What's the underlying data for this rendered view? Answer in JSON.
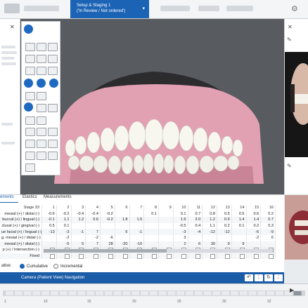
{
  "header": {
    "stage_tab_title": "Setup & Staging 1",
    "stage_tab_status": "('In Review / Not ordered')"
  },
  "table_tabs": [
    "ements",
    "Elastics",
    "Measurements"
  ],
  "table": {
    "header_label": "Stage 33",
    "columns": [
      "1",
      "2",
      "3",
      "4",
      "5",
      "6",
      "7",
      "8",
      "9",
      "10",
      "11",
      "12",
      "13",
      "14",
      "15",
      "16"
    ],
    "rows": [
      {
        "label": "mesial (+) / distal (-)",
        "cells": [
          "-0.6",
          "-0.2",
          "-0.4",
          "-0.4",
          "-0.2",
          "",
          "",
          "0.1",
          "",
          "0.1",
          "0.7",
          "0.8",
          "0.5",
          "0.5",
          "0.6",
          "0.2"
        ]
      },
      {
        "label": "buccal (+) / lingual (-)",
        "cells": [
          "-0.1",
          "1.1",
          "1.2",
          "0.6",
          "-0.2",
          "1.8",
          "1.5",
          "",
          "",
          "1.9",
          "2.0",
          "1.2",
          "0.9",
          "1.4",
          "1.4",
          "0.7"
        ]
      },
      {
        "label": "clusal (+) / gingival (-)",
        "cells": [
          "0.5",
          "0.1",
          "",
          "",
          "",
          "",
          "",
          "",
          "",
          "-0.5",
          "0.4",
          "1.1",
          "0.2",
          "0.1",
          "0.2",
          "0.3"
        ]
      },
      {
        "label": "ue facial (+) / lingual (-)",
        "cells": [
          "-13",
          "-3",
          "-1",
          "7",
          "",
          "6",
          "-1",
          "",
          "",
          "-3",
          "-4",
          "-12",
          "-12",
          "",
          "-6",
          "-9"
        ]
      },
      {
        "label": "g. mesial (+) / distal (-)",
        "cells": [
          "",
          "-2",
          "",
          "-2",
          "-6",
          "",
          "",
          "",
          "",
          "3",
          "",
          "",
          "",
          "",
          "-2",
          "6"
        ]
      },
      {
        "label": "mesial (+) / distal (-)",
        "cells": [
          "",
          "-5",
          "5",
          "7",
          "28",
          "-20",
          "-16",
          "",
          "",
          "2",
          "6",
          "30",
          "9",
          "9",
          "",
          ""
        ]
      },
      {
        "label": "p (+) / Intersection (-)",
        "cells": [
          "",
          "",
          "",
          "",
          "",
          "",
          "",
          "",
          "",
          "",
          "",
          "",
          "",
          "",
          "",
          ""
        ]
      },
      {
        "label": "Fixed",
        "cells": [
          "",
          "",
          "",
          "",
          "",
          "",
          "",
          "",
          "",
          "",
          "",
          "",
          "",
          "",
          "",
          ""
        ]
      }
    ]
  },
  "relative": {
    "label": "ative:",
    "options": [
      "Cumulative",
      "Incremental"
    ],
    "selected": "Cumulative"
  },
  "nav": {
    "label": "Camera (Patient View) Navigation"
  },
  "timeline": {
    "ticks": [
      "1",
      "10",
      "15",
      "20",
      "25",
      "30",
      "32"
    ]
  },
  "colors": {
    "accent": "#1b63b5",
    "viewport_bg": "#585b60",
    "gum": "#e7a7b7",
    "tooth": "#f6f5ee"
  }
}
